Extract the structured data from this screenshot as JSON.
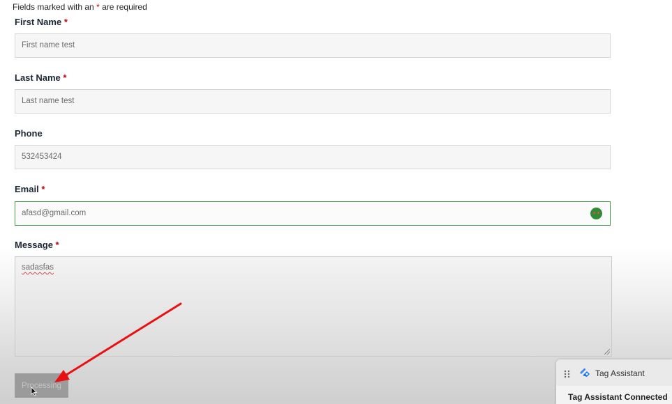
{
  "form": {
    "required_note_prefix": "Fields marked with an",
    "required_star": "*",
    "required_note_suffix": "are required",
    "first_name": {
      "label": "First Name",
      "required_mark": "*",
      "value": "First name test"
    },
    "last_name": {
      "label": "Last Name",
      "required_mark": "*",
      "value": "Last name test"
    },
    "phone": {
      "label": "Phone",
      "value": "532453424"
    },
    "email": {
      "label": "Email",
      "required_mark": "*",
      "value": "afasd@gmail.com"
    },
    "message": {
      "label": "Message",
      "required_mark": "*",
      "value": "sadasfas"
    },
    "submit_label": "Processing"
  },
  "tag_assistant": {
    "title": "Tag Assistant",
    "status": "Tag Assistant Connected",
    "logo_icon": "tag-assistant-icon"
  },
  "colors": {
    "required_star": "#c2001a",
    "email_active_border": "#3f9a45",
    "annotation_arrow": "#e81010"
  }
}
